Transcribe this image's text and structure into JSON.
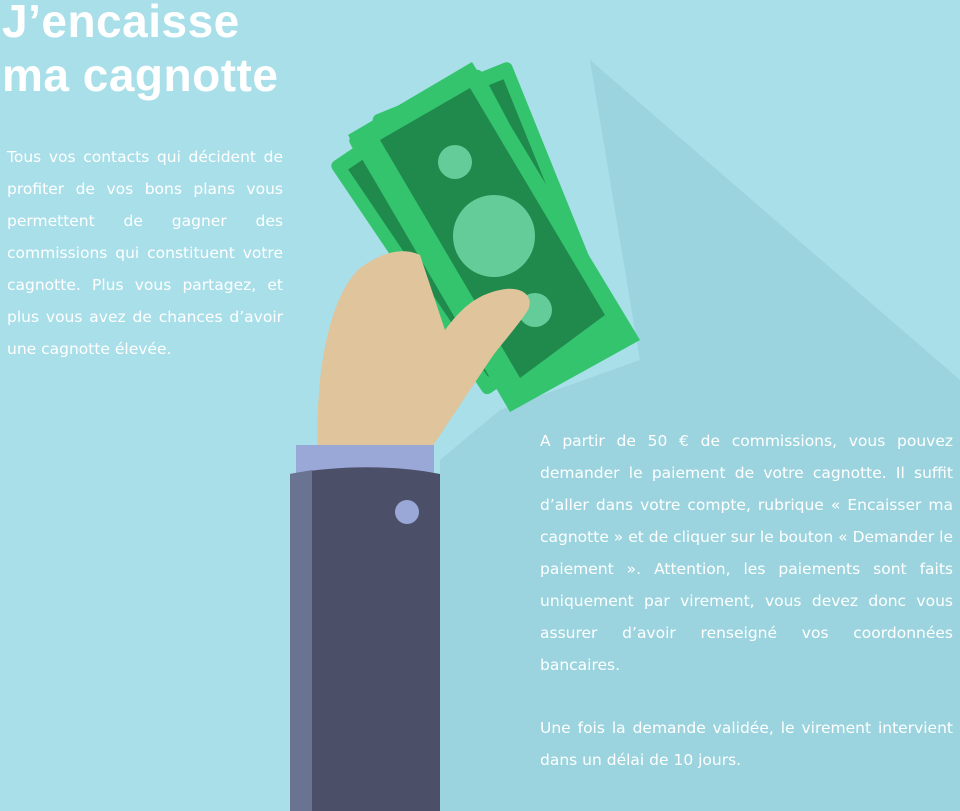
{
  "title": {
    "line1": "J’encaisse",
    "line2": "ma cagnotte"
  },
  "intro": "Tous vos contacts qui décident de profiter de vos bons plans vous permettent de gagner des commissions qui constituent votre cagnotte. Plus vous partagez, et plus vous avez de chances d’avoir une cagnotte élevée.",
  "payment": "A partir de 50 € de commissions, vous pouvez demander le paiement de votre cagnotte. Il suffit d’aller dans votre compte, rubrique « Encaisser ma cagnotte » et de cliquer sur le bouton « Demander le paiement ». Attention, les paiements sont faits uniquement par virement, vous devez donc vous assurer d’avoir renseigné vos coordonnées bancaires.",
  "delay": "Une fois la demande validée, le virement intervient dans un délai de 10 jours.",
  "colors": {
    "background": "#a9dfe9",
    "bill_light": "#35c46e",
    "bill_dark": "#1f8a4c",
    "skin": "#e0c49b",
    "sleeve": "#4b5068",
    "cuff": "#9aa8d8"
  },
  "illustration": {
    "icon": "hand-holding-cash-icon"
  }
}
